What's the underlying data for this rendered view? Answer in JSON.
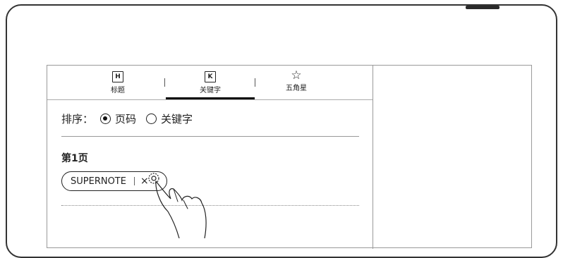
{
  "tabs": [
    {
      "icon_letter": "H",
      "label": "标题",
      "icon": "heading-icon"
    },
    {
      "icon_letter": "K",
      "label": "关键字",
      "icon": "keyword-icon",
      "active": true
    },
    {
      "icon_glyph": "☆",
      "label": "五角星",
      "icon": "star-icon"
    }
  ],
  "sort": {
    "label": "排序：",
    "options": [
      {
        "label": "页码",
        "selected": true
      },
      {
        "label": "关键字",
        "selected": false
      }
    ]
  },
  "page_group": {
    "heading": "第1页",
    "keyword_chip": {
      "text": "SUPERNOTE",
      "delete_glyph": "×"
    }
  }
}
